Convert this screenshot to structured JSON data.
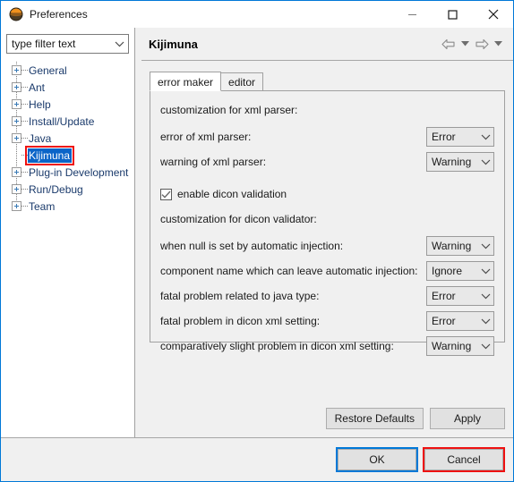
{
  "window": {
    "title": "Preferences",
    "app_icon": "eclipse-globe-icon",
    "minimize_label": "Minimize",
    "maximize_label": "Maximize",
    "close_label": "Close"
  },
  "sidebar": {
    "filter": {
      "value": "type filter text",
      "placeholder": "type filter text"
    },
    "items": [
      {
        "label": "General",
        "expandable": true,
        "selected": false
      },
      {
        "label": "Ant",
        "expandable": true,
        "selected": false
      },
      {
        "label": "Help",
        "expandable": true,
        "selected": false
      },
      {
        "label": "Install/Update",
        "expandable": true,
        "selected": false
      },
      {
        "label": "Java",
        "expandable": true,
        "selected": false
      },
      {
        "label": "Kijimuna",
        "expandable": false,
        "selected": true
      },
      {
        "label": "Plug-in Development",
        "expandable": true,
        "selected": false
      },
      {
        "label": "Run/Debug",
        "expandable": true,
        "selected": false
      },
      {
        "label": "Team",
        "expandable": true,
        "selected": false
      }
    ]
  },
  "page": {
    "title": "Kijimuna",
    "nav_back_label": "Back",
    "nav_back_menu_label": "Back history",
    "nav_forward_label": "Forward",
    "nav_forward_menu_label": "Forward history"
  },
  "tabs": [
    {
      "label": "error maker",
      "active": true
    },
    {
      "label": "editor",
      "active": false
    }
  ],
  "xml_parser_section": {
    "heading": "customization for xml parser:",
    "rows": [
      {
        "label": "error of xml parser:",
        "value": "Error"
      },
      {
        "label": "warning of xml parser:",
        "value": "Warning"
      }
    ]
  },
  "dicon_section": {
    "checkbox": {
      "label": "enable dicon validation",
      "checked": true
    },
    "heading": "customization for dicon validator:",
    "rows": [
      {
        "label": "when null is set by automatic injection:",
        "value": "Warning"
      },
      {
        "label": "component name which can leave automatic injection:",
        "value": "Ignore"
      },
      {
        "label": "fatal problem related to java type:",
        "value": "Error"
      },
      {
        "label": "fatal problem in dicon xml setting:",
        "value": "Error"
      },
      {
        "label": "comparatively slight problem in dicon xml setting:",
        "value": "Warning"
      }
    ]
  },
  "actions": {
    "restore_defaults": "Restore Defaults",
    "apply": "Apply"
  },
  "footer": {
    "ok": "OK",
    "cancel": "Cancel"
  },
  "colors": {
    "accent_blue": "#0078d7",
    "selection_blue": "#0a64c8",
    "annotation_red": "#ee1111",
    "dialog_bg": "#f0f0f0",
    "panel_white": "#ffffff"
  }
}
